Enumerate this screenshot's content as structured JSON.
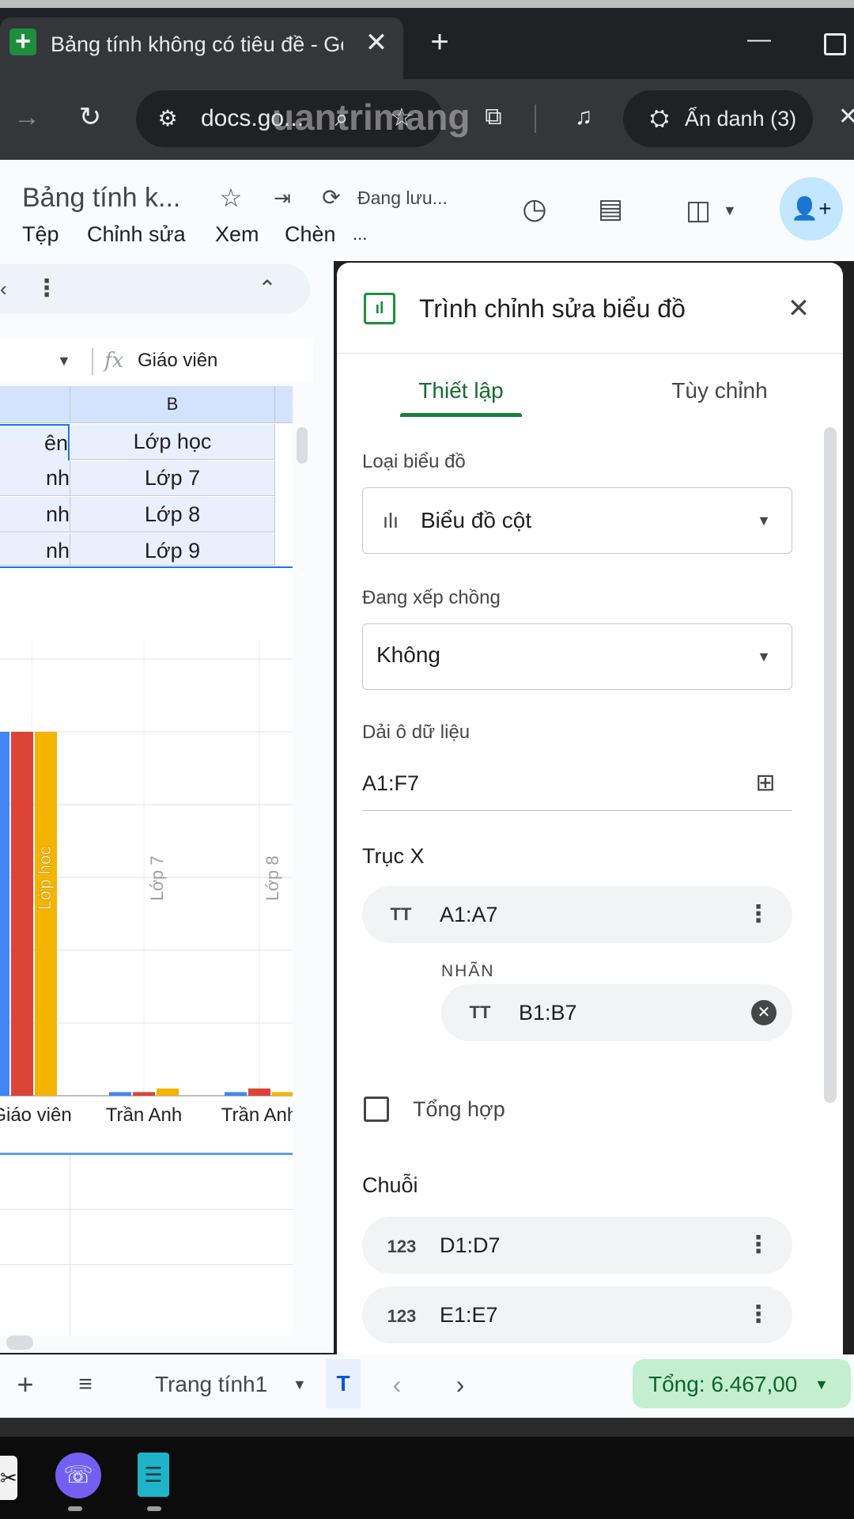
{
  "browser": {
    "tab_title": "Bảng tính không có tiêu đề - Gc",
    "tab_close": "✕",
    "new_tab": "+",
    "url": "docs.go...",
    "incognito_label": "Ẩn danh (3)",
    "watermark": "uantrimang"
  },
  "sheets": {
    "doc_title": "Bảng tính k...",
    "status": "Đang lưu...",
    "menus": [
      "Tệp",
      "Chỉnh sửa",
      "Xem",
      "Chèn",
      "..."
    ],
    "formula_value": "Giáo viên",
    "fx": "fx",
    "column_header": "B",
    "rows": [
      {
        "a": "ên",
        "b": "Lớp học"
      },
      {
        "a": "nh",
        "b": "Lớp 7"
      },
      {
        "a": "nh",
        "b": "Lớp 8"
      },
      {
        "a": "nh",
        "b": "Lớp 9"
      }
    ]
  },
  "chart_data": {
    "type": "bar",
    "categories": [
      "Giáo viên",
      "Trần Anh",
      "Trần Anh"
    ],
    "bar_labels": [
      "Lớp học",
      "Lớp 7",
      "Lớp 8"
    ],
    "series": [
      {
        "values": [
          100,
          1,
          1
        ],
        "color": "#4285f4"
      },
      {
        "values": [
          100,
          1,
          2
        ],
        "color": "#db4437"
      },
      {
        "values": [
          100,
          2,
          1
        ],
        "color": "#f4b400"
      }
    ],
    "ylim": [
      0,
      100
    ]
  },
  "editor": {
    "title": "Trình chỉnh sửa biểu đồ",
    "tab_setup": "Thiết lập",
    "tab_customize": "Tùy chỉnh",
    "chart_type_label": "Loại biểu đồ",
    "chart_type_value": "Biểu đồ cột",
    "stacking_label": "Đang xếp chồng",
    "stacking_value": "Không",
    "data_range_label": "Dải ô dữ liệu",
    "data_range_value": "A1:F7",
    "x_axis_label": "Trục X",
    "x_axis_range": "A1:A7",
    "label_heading": "NHÃN",
    "label_range": "B1:B7",
    "aggregate_label": "Tổng hợp",
    "series_heading": "Chuỗi",
    "series": [
      "D1:D7",
      "E1:E7"
    ],
    "text_icon": "TT",
    "number_icon": "123"
  },
  "bottom": {
    "sheet_tab": "Trang tính1",
    "sheet_tab2": "T",
    "sum_label": "Tổng: 6.467,00"
  },
  "accent": {
    "green": "#188038",
    "blue": "#1a73e8"
  }
}
